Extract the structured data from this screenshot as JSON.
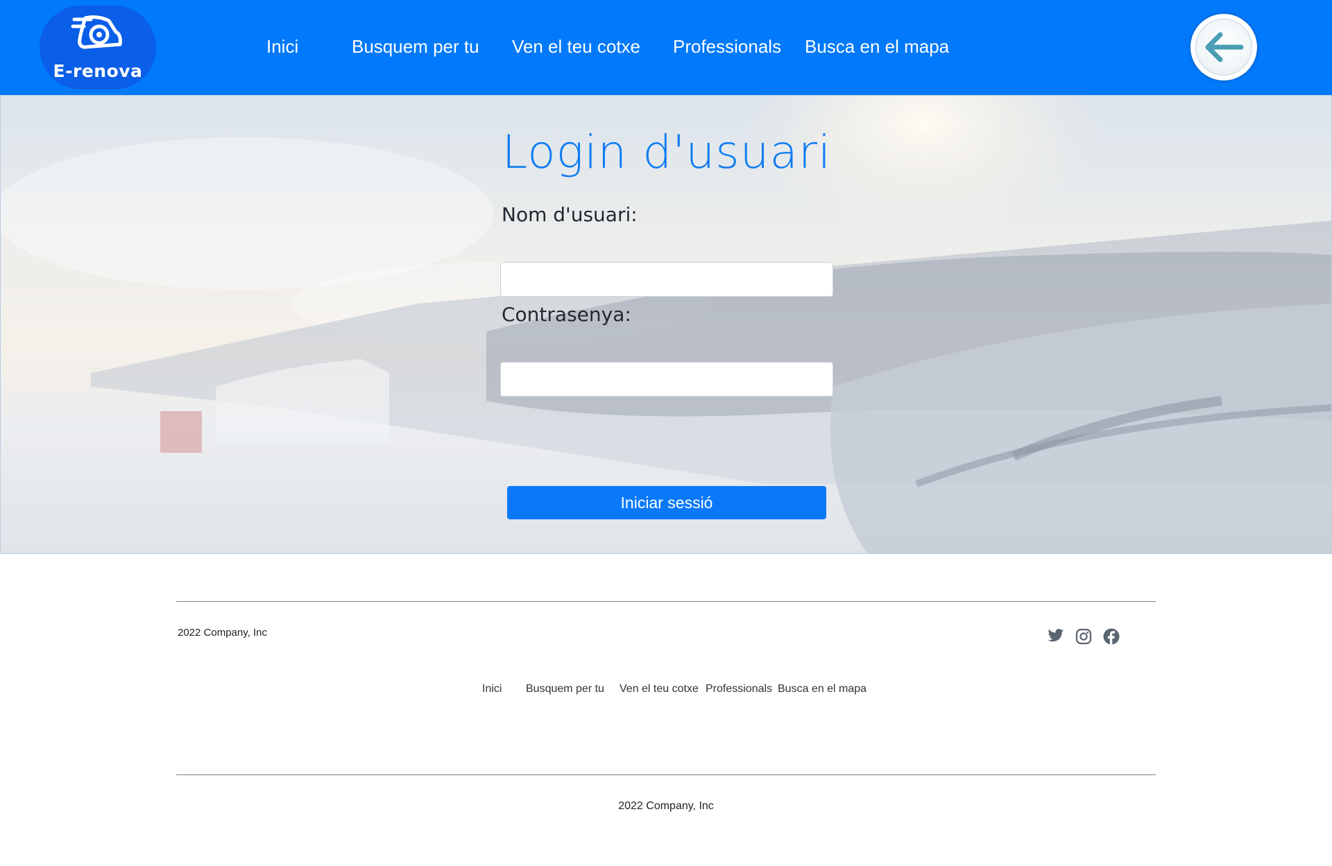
{
  "header": {
    "logo_text": "E-renova",
    "nav": [
      {
        "label": "Inici"
      },
      {
        "label": "Busquem per tu"
      },
      {
        "label": "Ven el teu cotxe"
      },
      {
        "label": "Professionals"
      },
      {
        "label": "Busca en el mapa"
      }
    ],
    "back_icon": "arrow-left-icon"
  },
  "login": {
    "title": "Login d'usuari",
    "username_label": "Nom d'usuari:",
    "username_value": "",
    "password_label": "Contrasenya:",
    "password_value": "",
    "submit_label": "Iniciar sessió"
  },
  "footer": {
    "copyright": "2022 Company, Inc",
    "social": [
      "twitter-icon",
      "instagram-icon",
      "facebook-icon"
    ],
    "links": [
      {
        "label": "Inici"
      },
      {
        "label": "Busquem per tu"
      },
      {
        "label": "Ven el teu cotxe"
      },
      {
        "label": "Professionals"
      },
      {
        "label": "Busca en el mapa"
      }
    ],
    "bottom_copyright": "2022 Company, Inc"
  },
  "colors": {
    "brand_blue": "#0079fb",
    "title_blue": "#0f7cf2",
    "button_blue": "#0a79f9"
  }
}
